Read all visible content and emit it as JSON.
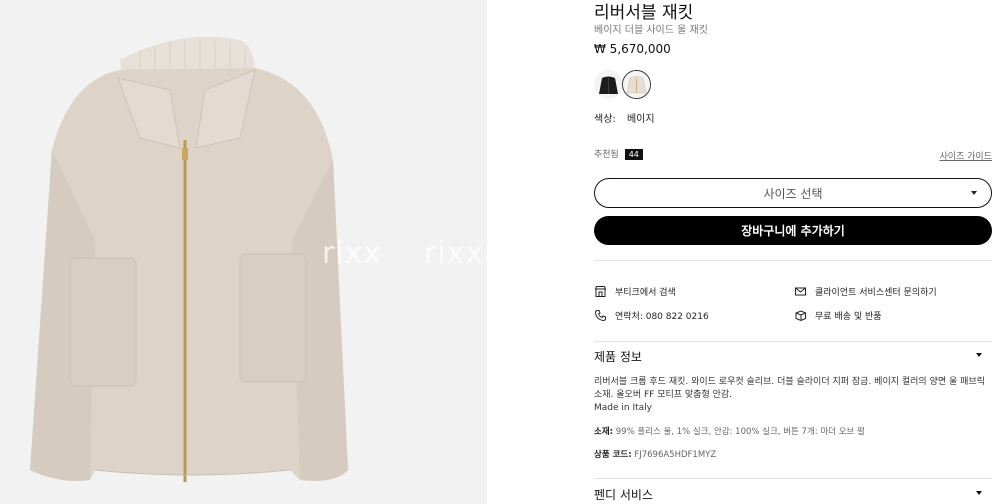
{
  "gallery": {
    "watermark_1": "rixx",
    "watermark_2": "rixx",
    "image_alt": "beige-reversible-jacket-photo"
  },
  "product": {
    "title": "리버서블 재킷",
    "subtitle": "베이지 더블 사이드 울 재킷",
    "price": "₩ 5,670,000",
    "color_label": "색상:",
    "color_value": "베이지",
    "swatches": [
      {
        "name": "black",
        "color": "#1b1b1b",
        "selected": false
      },
      {
        "name": "beige",
        "color": "#e6ded6",
        "selected": true
      }
    ]
  },
  "size": {
    "recommended_label": "추천됨",
    "recommended_value": "44",
    "guide_label": "사이즈 가이드",
    "select_label": "사이즈 선택"
  },
  "actions": {
    "add_to_cart": "장바구니에 추가하기"
  },
  "services": {
    "boutique_search": "부티크에서 검색",
    "client_service": "클라이언트 서비스센터 문의하기",
    "contact": "연락처: 080 822 0216",
    "shipping": "무료 배송 및 반품"
  },
  "product_info": {
    "heading": "제품 정보",
    "description": "리버서블 크롭 후드 재킷. 와이드 로우컷 슬리브. 더블 슬라이더 지퍼 잠금. 베이지 컬러의 양면 울 패브릭 소재. 올오버 FF 모티프 맞춤형 안감.",
    "origin": "Made in Italy",
    "material_label": "소재:",
    "material_value": "99% 플리스 울, 1% 실크, 안감: 100% 실크, 버튼 7개: 마더 오브 펄",
    "code_label": "상품 코드:",
    "code_value": "FJ7696A5HDF1MYZ"
  },
  "fendi_service": {
    "heading": "펜디 서비스"
  },
  "colors": {
    "background_left": "#f2f2f2",
    "jacket": "#dfd5cb",
    "button_black": "#000000"
  }
}
